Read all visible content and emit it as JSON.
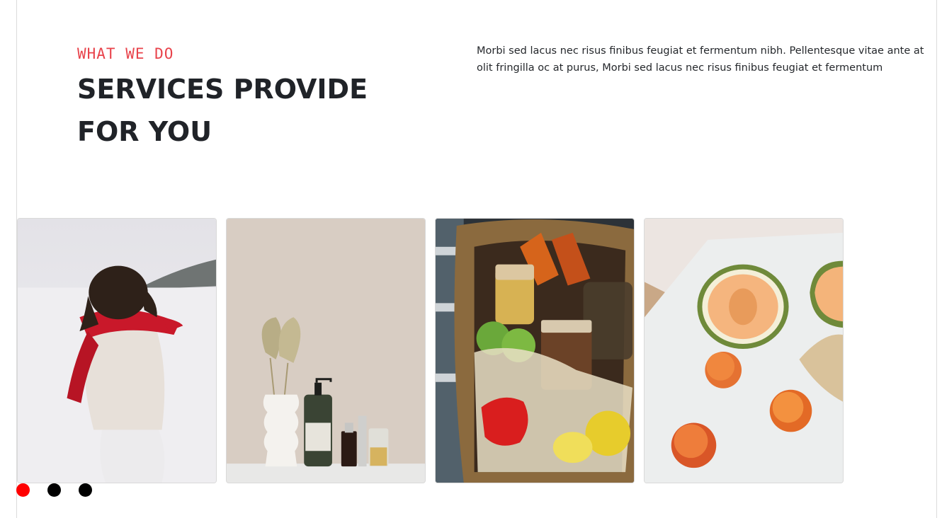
{
  "section": {
    "eyebrow": "WHAT WE DO",
    "title_line1": "SERVICES PROVIDE",
    "title_line2": "FOR YOU",
    "description": "Morbi sed lacus nec risus finibus feugiat et fermentum nibh. Pellentesque vitae ante at olit fringilla oc at purus, Morbi sed lacus nec risus finibus feugiat et fermentum"
  },
  "gallery": {
    "cards": [
      {
        "subject": "woman-red-scarf-snow"
      },
      {
        "subject": "dried-palm-vase-cosmetics"
      },
      {
        "subject": "wicker-basket-groceries"
      },
      {
        "subject": "melon-apricots-table"
      }
    ]
  },
  "pagination": {
    "count": 3,
    "active_index": 0
  },
  "colors": {
    "accent": "#e8434b",
    "heading": "#202328",
    "dot_active": "#ff0000",
    "dot_inactive": "#000000"
  }
}
